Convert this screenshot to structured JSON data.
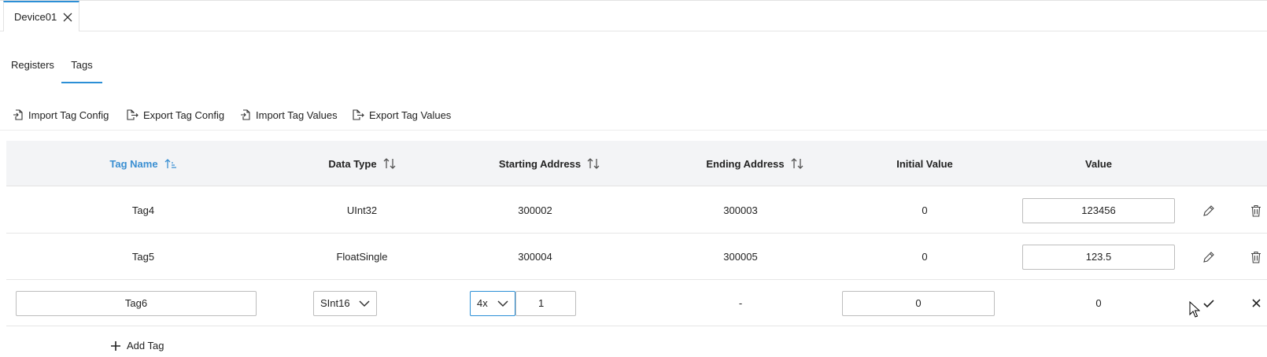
{
  "document_tab": {
    "label": "Device01",
    "close_icon": "close-icon"
  },
  "subtabs": [
    {
      "label": "Registers",
      "active": false
    },
    {
      "label": "Tags",
      "active": true
    }
  ],
  "toolbar": {
    "import_config": "Import Tag Config",
    "export_config": "Export Tag Config",
    "import_values": "Import Tag Values",
    "export_values": "Export Tag Values"
  },
  "table": {
    "headers": {
      "tag_name": "Tag Name",
      "data_type": "Data Type",
      "starting_address": "Starting Address",
      "ending_address": "Ending Address",
      "initial_value": "Initial Value",
      "value": "Value"
    },
    "rows": [
      {
        "tag_name": "Tag4",
        "data_type": "UInt32",
        "starting_address": "300002",
        "ending_address": "300003",
        "initial_value": "0",
        "value": "123456"
      },
      {
        "tag_name": "Tag5",
        "data_type": "FloatSingle",
        "starting_address": "300004",
        "ending_address": "300005",
        "initial_value": "0",
        "value": "123.5"
      }
    ],
    "edit_row": {
      "tag_name": "Tag6",
      "data_type": "SInt16",
      "address_prefix": "4x",
      "address_offset": "1",
      "ending_address": "-",
      "initial_value": "0",
      "value": "0"
    }
  },
  "add_tag": {
    "label": "Add Tag"
  },
  "colors": {
    "accent": "#2c8fd6",
    "sorted_header": "#3a8fd2",
    "header_bg": "#f3f4f6"
  }
}
